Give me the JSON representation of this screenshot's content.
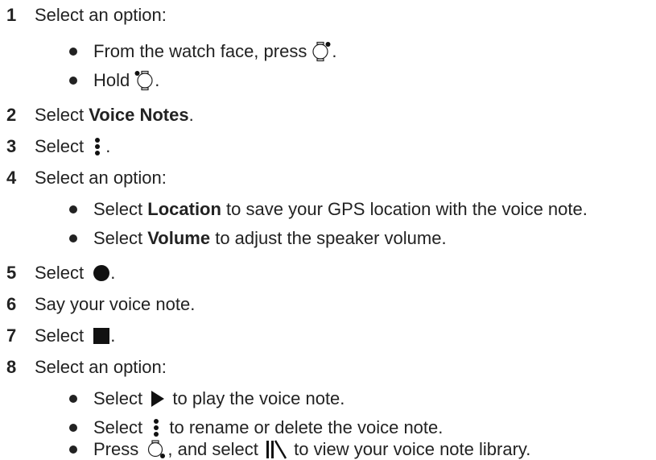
{
  "steps": [
    {
      "num": "1",
      "text": "Select an option:"
    },
    {
      "num": "2",
      "pre": "Select ",
      "bold": "Voice Notes",
      "post": "."
    },
    {
      "num": "3",
      "pre": "Select ",
      "post": "."
    },
    {
      "num": "4",
      "text": "Select an option:"
    },
    {
      "num": "5",
      "pre": "Select ",
      "post": "."
    },
    {
      "num": "6",
      "text": "Say your voice note."
    },
    {
      "num": "7",
      "pre": "Select ",
      "post": "."
    },
    {
      "num": "8",
      "text": "Select an option:"
    }
  ],
  "step1_bullets": [
    {
      "pre": "From the watch face, press ",
      "post": "."
    },
    {
      "pre": "Hold ",
      "post": "."
    }
  ],
  "step4_bullets": [
    {
      "pre": "Select ",
      "bold": "Location",
      "post": " to save your GPS location with the voice note."
    },
    {
      "pre": "Select ",
      "bold": "Volume",
      "post": " to adjust the speaker volume."
    }
  ],
  "step8_bullets": [
    {
      "pre": "Select ",
      "post": " to play the voice note."
    },
    {
      "pre": "Select ",
      "post": " to rename or delete the voice note."
    },
    {
      "pre": "Press ",
      "mid": ", and select ",
      "post": " to view your voice note library."
    }
  ],
  "icons": {
    "watch_button_top_right": "watch-top-right-button-icon",
    "watch_button_top_left": "watch-top-left-button-icon",
    "watch_button_bottom_right": "watch-bottom-right-button-icon",
    "menu": "vertical-dots-icon",
    "record": "filled-circle-icon",
    "stop": "filled-square-icon",
    "play": "play-triangle-icon",
    "library": "library-icon"
  },
  "colors": {
    "text": "#222222",
    "icon": "#111111"
  }
}
